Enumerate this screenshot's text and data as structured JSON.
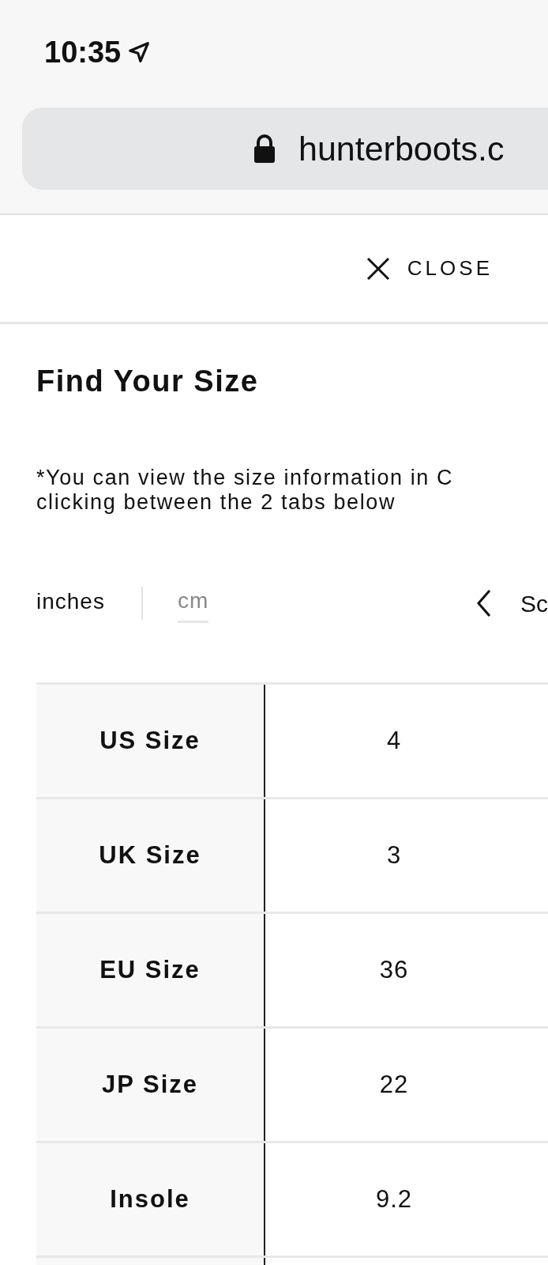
{
  "status_bar": {
    "time": "10:35"
  },
  "address_bar": {
    "url": "hunterboots.c"
  },
  "close_button": {
    "label": "CLOSE"
  },
  "title": "Find Your Size",
  "note": "*You can view the size information in C\nclicking between the 2 tabs below",
  "unit_tabs": [
    {
      "label": "inches",
      "selected": true
    },
    {
      "label": "cm",
      "selected": false
    }
  ],
  "pager": {
    "label": "Sc"
  },
  "size_table": {
    "rows": [
      {
        "label": "US Size",
        "value": "4"
      },
      {
        "label": "UK Size",
        "value": "3"
      },
      {
        "label": "EU Size",
        "value": "36"
      },
      {
        "label": "JP Size",
        "value": "22"
      },
      {
        "label": "Insole",
        "value": "9.2"
      }
    ]
  }
}
